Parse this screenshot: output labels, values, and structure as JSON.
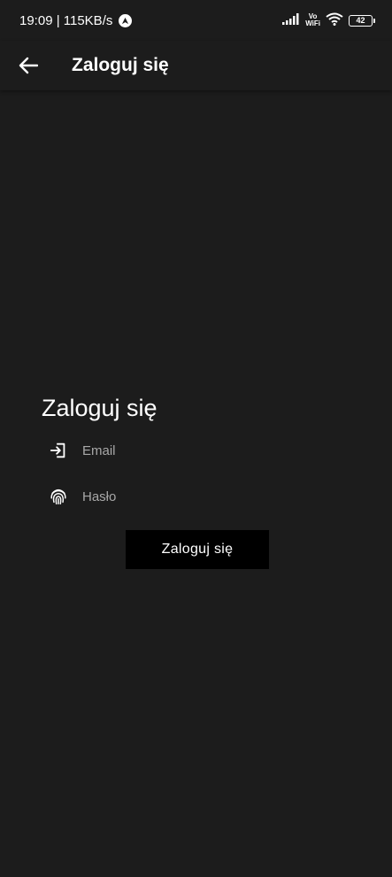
{
  "status_bar": {
    "time_speed": "19:09 | 115KB/s",
    "vo_label": "Vo",
    "wifi_label": "WiFi",
    "battery": "42",
    "icons": [
      "navigation-icon",
      "signal-icon",
      "wifi-icon",
      "battery-icon"
    ]
  },
  "app_bar": {
    "back_icon": "arrow-left-icon",
    "title": "Zaloguj się"
  },
  "form": {
    "title": "Zaloguj się",
    "email": {
      "icon": "login-icon",
      "placeholder": "Email",
      "value": ""
    },
    "password": {
      "icon": "fingerprint-icon",
      "placeholder": "Hasło",
      "value": ""
    },
    "submit_label": "Zaloguj się"
  },
  "colors": {
    "background": "#1c1c1c",
    "button_background": "#000000",
    "text": "#ffffff",
    "placeholder": "#a8a8a8"
  }
}
